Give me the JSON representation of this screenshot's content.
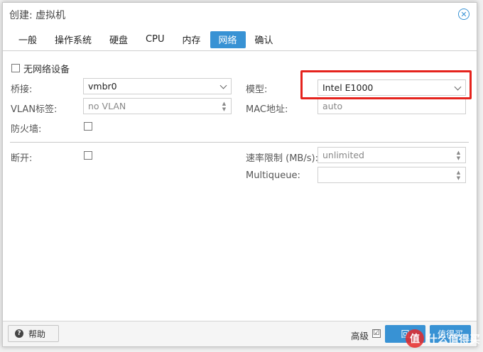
{
  "dialog": {
    "title": "创建: 虚拟机"
  },
  "tabs": [
    {
      "label": "一般"
    },
    {
      "label": "操作系统"
    },
    {
      "label": "硬盘"
    },
    {
      "label": "CPU"
    },
    {
      "label": "内存"
    },
    {
      "label": "网络",
      "active": true
    },
    {
      "label": "确认"
    }
  ],
  "network": {
    "no_network_label": "无网络设备",
    "bridge_label": "桥接:",
    "bridge_value": "vmbr0",
    "vlan_label": "VLAN标签:",
    "vlan_value": "no VLAN",
    "firewall_label": "防火墙:",
    "model_label": "模型:",
    "model_value": "Intel E1000",
    "mac_label": "MAC地址:",
    "mac_placeholder": "auto",
    "disconnect_label": "断开:",
    "rate_label": "速率限制 (MB/s):",
    "rate_placeholder": "unlimited",
    "multiqueue_label": "Multiqueue:",
    "multiqueue_value": ""
  },
  "footer": {
    "help_label": "帮助",
    "advanced_label": "高级",
    "advanced_checked": "☑",
    "back_label": "回",
    "next_label": "值得买"
  },
  "watermark": {
    "badge": "值",
    "text": "什么值得买"
  },
  "colors": {
    "accent": "#3892d4",
    "highlight": "#e5231d"
  }
}
